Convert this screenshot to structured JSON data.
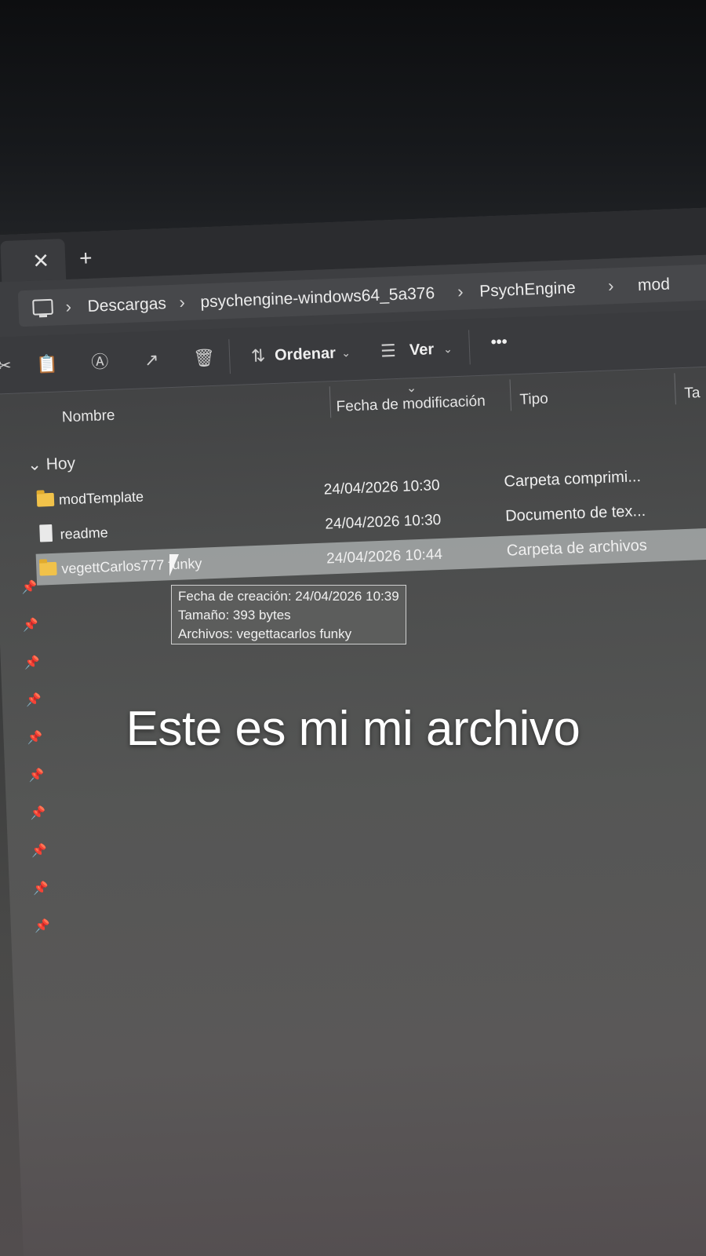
{
  "tabs": {
    "close_glyph": "✕",
    "add_glyph": "+"
  },
  "breadcrumb": {
    "items": [
      "Descargas",
      "psychengine-windows64_5a376",
      "PsychEngine",
      "mod"
    ],
    "separator": "›"
  },
  "toolbar": {
    "sort_label": "Ordenar",
    "view_label": "Ver",
    "more_glyph": "•••"
  },
  "columns": {
    "name": "Nombre",
    "modified": "Fecha de modificación",
    "type": "Tipo",
    "size": "Ta"
  },
  "group": {
    "label": "Hoy"
  },
  "files": [
    {
      "name": "modTemplate",
      "date": "24/04/2026 10:30",
      "type": "Carpeta comprimi...",
      "icon": "folder-icon"
    },
    {
      "name": "readme",
      "date": "24/04/2026 10:30",
      "type": "Documento de tex...",
      "icon": "file-icon"
    },
    {
      "name": "vegettCarlos777 funky",
      "date": "24/04/2026 10:44",
      "type": "Carpeta de archivos",
      "icon": "folder-icon",
      "selected": true
    }
  ],
  "tooltip": {
    "line1": "Fecha de creación: 24/04/2026 10:39",
    "line2": "Tamaño: 393 bytes",
    "line3": "Archivos: vegettacarlos funky"
  },
  "caption": "Este es mi mi archivo",
  "colors": {
    "folder": "#f1c24a",
    "selection": "#c8cdcd"
  }
}
